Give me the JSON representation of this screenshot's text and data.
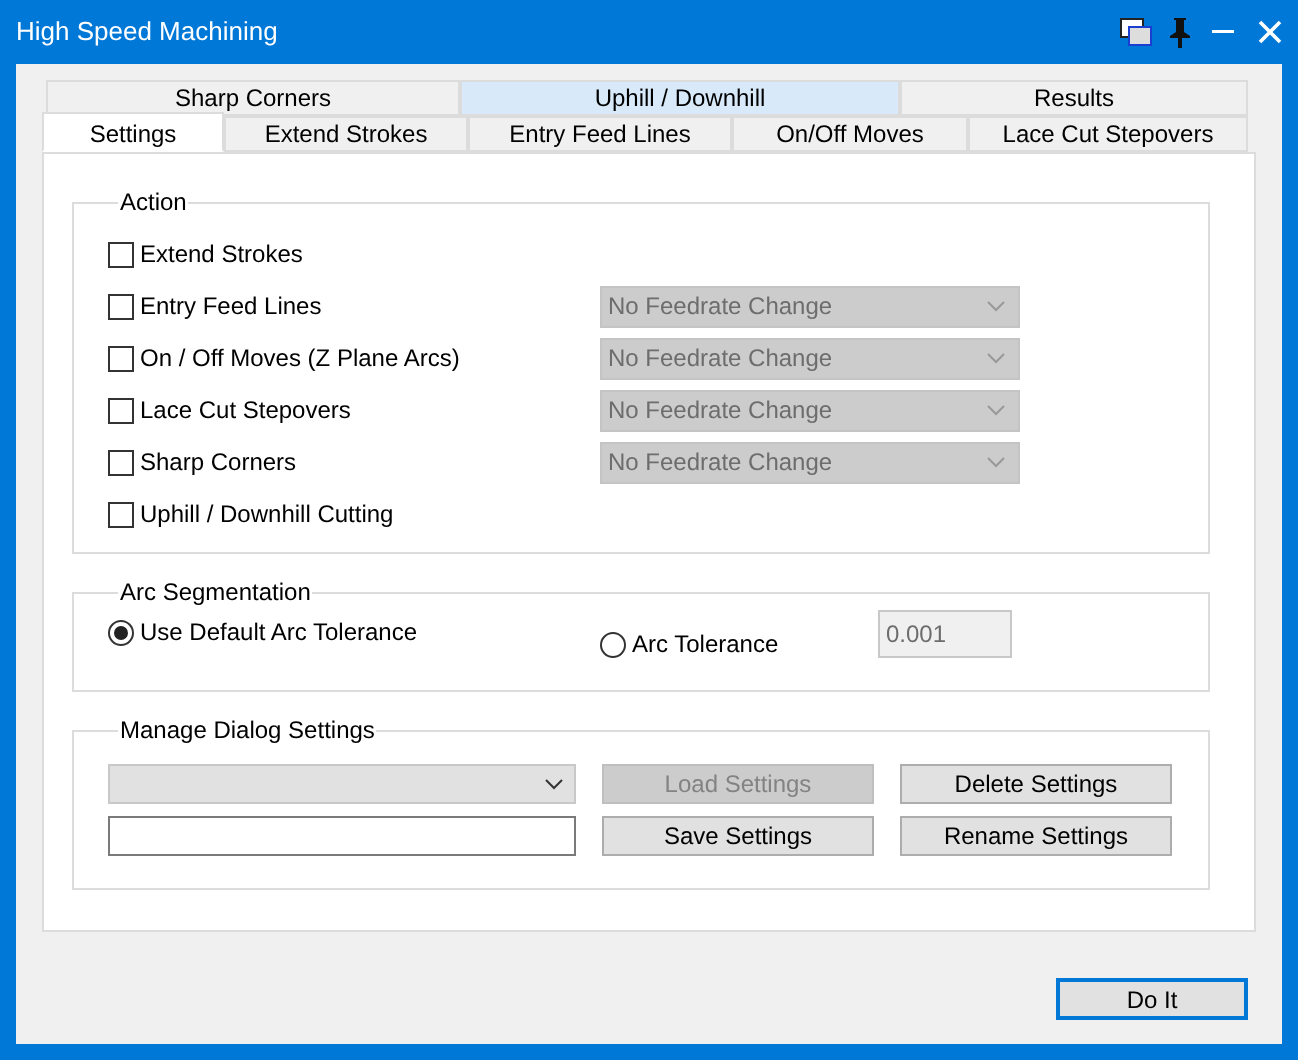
{
  "window": {
    "title": "High Speed Machining"
  },
  "tab_rows": [
    {
      "tabs": [
        {
          "label": "Sharp Corners",
          "selected": false,
          "highlighted": false
        },
        {
          "label": "Uphill / Downhill",
          "selected": false,
          "highlighted": true
        },
        {
          "label": "Results",
          "selected": false,
          "highlighted": false
        }
      ]
    },
    {
      "tabs": [
        {
          "label": "Settings",
          "selected": true,
          "highlighted": false
        },
        {
          "label": "Extend Strokes",
          "selected": false,
          "highlighted": false
        },
        {
          "label": "Entry Feed Lines",
          "selected": false,
          "highlighted": false
        },
        {
          "label": "On/Off Moves",
          "selected": false,
          "highlighted": false
        },
        {
          "label": "Lace Cut Stepovers",
          "selected": false,
          "highlighted": false
        }
      ]
    }
  ],
  "action": {
    "title": "Action",
    "options": [
      {
        "label": "Extend Strokes",
        "checked": false
      },
      {
        "label": "Entry Feed Lines",
        "checked": false,
        "feedrate": {
          "value": "No Feedrate Change",
          "disabled": true
        }
      },
      {
        "label": "On / Off Moves (Z Plane Arcs)",
        "checked": false,
        "feedrate": {
          "value": "No Feedrate Change",
          "disabled": true
        }
      },
      {
        "label": "Lace Cut Stepovers",
        "checked": false,
        "feedrate": {
          "value": "No Feedrate Change",
          "disabled": true
        }
      },
      {
        "label": "Sharp Corners",
        "checked": false,
        "feedrate": {
          "value": "No Feedrate Change",
          "disabled": true
        }
      },
      {
        "label": "Uphill / Downhill Cutting",
        "checked": false
      }
    ]
  },
  "arc_segmentation": {
    "title": "Arc Segmentation",
    "options": [
      {
        "label": "Use Default Arc Tolerance",
        "selected": true
      },
      {
        "label": "Arc Tolerance",
        "selected": false
      }
    ],
    "tolerance": {
      "value": "0.001",
      "disabled": true
    }
  },
  "manage": {
    "title": "Manage Dialog Settings",
    "buttons": [
      {
        "label": "Load Settings",
        "disabled": true
      },
      {
        "label": "Delete Settings",
        "disabled": false
      },
      {
        "label": "Save Settings",
        "disabled": false
      },
      {
        "label": "Rename Settings",
        "disabled": false
      }
    ]
  },
  "do_it": {
    "label": "Do It",
    "default": true
  }
}
